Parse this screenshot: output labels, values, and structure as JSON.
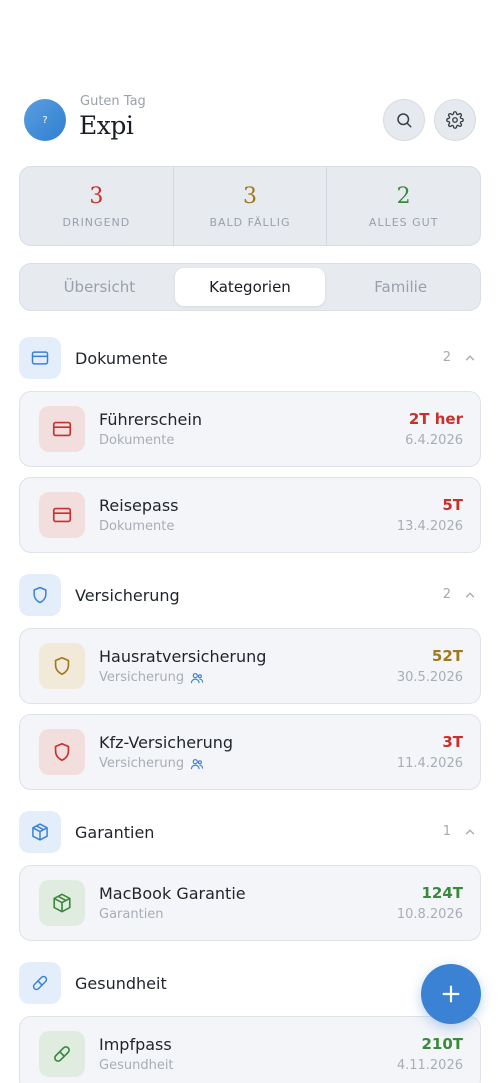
{
  "header": {
    "avatar_letter": "?",
    "greeting": "Guten Tag",
    "app_name": "Expi"
  },
  "stats": [
    {
      "value": "3",
      "label": "DRINGEND",
      "color": "#c9302c"
    },
    {
      "value": "3",
      "label": "BALD FÄLLIG",
      "color": "#a0781e"
    },
    {
      "value": "2",
      "label": "ALLES GUT",
      "color": "#3a8a3e"
    }
  ],
  "tabs": [
    "Übersicht",
    "Kategorien",
    "Familie"
  ],
  "active_tab": "Kategorien",
  "categories": [
    {
      "name": "Dokumente",
      "count": "2",
      "icon": "card-icon",
      "items": [
        {
          "title": "Führerschein",
          "subtitle": "Dokumente",
          "due": "2T her",
          "date": "6.4.2026",
          "status_color": "#c9302c",
          "icon": "card-icon",
          "shared": false
        },
        {
          "title": "Reisepass",
          "subtitle": "Dokumente",
          "due": "5T",
          "date": "13.4.2026",
          "status_color": "#c9302c",
          "icon": "card-icon",
          "shared": false
        }
      ]
    },
    {
      "name": "Versicherung",
      "count": "2",
      "icon": "shield-icon",
      "items": [
        {
          "title": "Hausratversicherung",
          "subtitle": "Versicherung",
          "due": "52T",
          "date": "30.5.2026",
          "status_color": "#a0781e",
          "icon": "shield-icon",
          "shared": true
        },
        {
          "title": "Kfz-Versicherung",
          "subtitle": "Versicherung",
          "due": "3T",
          "date": "11.4.2026",
          "status_color": "#c9302c",
          "icon": "shield-icon",
          "shared": true
        }
      ]
    },
    {
      "name": "Garantien",
      "count": "1",
      "icon": "box-icon",
      "items": [
        {
          "title": "MacBook Garantie",
          "subtitle": "Garantien",
          "due": "124T",
          "date": "10.8.2026",
          "status_color": "#3a8a3e",
          "icon": "box-icon",
          "shared": false
        }
      ]
    },
    {
      "name": "Gesundheit",
      "count": "",
      "icon": "pill-icon",
      "items": [
        {
          "title": "Impfpass",
          "subtitle": "Gesundheit",
          "due": "210T",
          "date": "4.11.2026",
          "status_color": "#3a8a3e",
          "icon": "pill-icon",
          "shared": false
        }
      ]
    }
  ],
  "colors": {
    "accent": "#3b82d4",
    "urgent": "#c9302c",
    "soon": "#a0781e",
    "ok": "#3a8a3e"
  }
}
